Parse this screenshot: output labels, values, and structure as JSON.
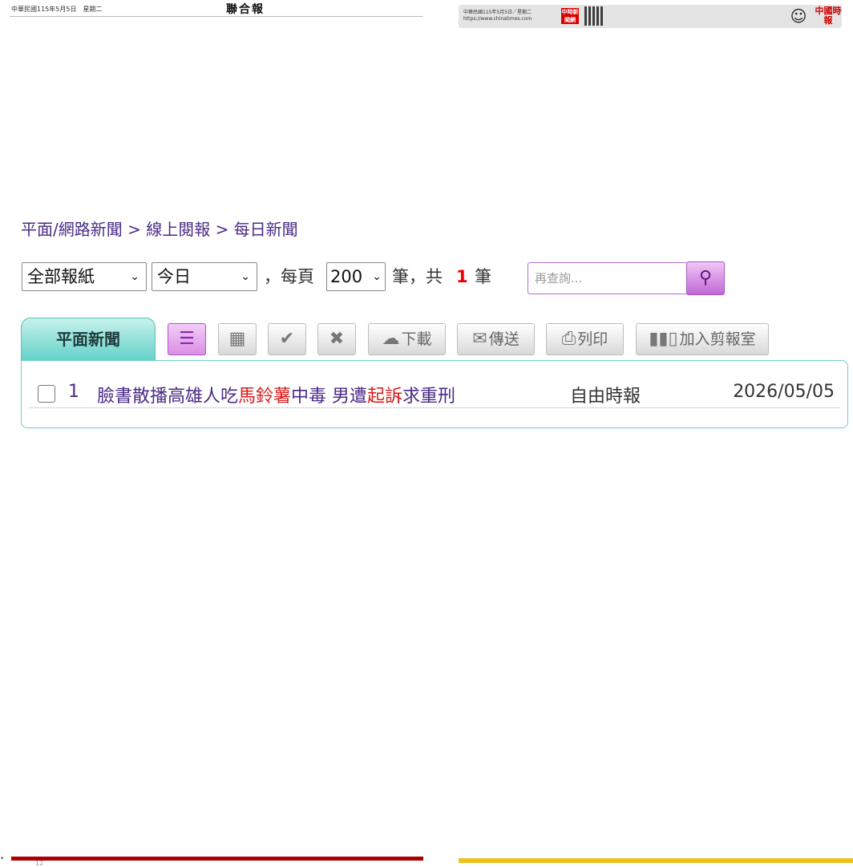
{
  "top_strip_left": {
    "date": "中華民國115年5月5日　星期二",
    "logo": "聯合報"
  },
  "top_strip_right": {
    "date_line1": "中華民國115年5月5日／星期二",
    "date_line2": "https://www.chinatimes.com",
    "badge": "中時新聞網",
    "logo": "中國時報"
  },
  "bottom": {
    "page_number": "12"
  },
  "breadcrumb": "平面/網路新聞 > 線上閱報 > 每日新聞",
  "filters": {
    "paper_select": "全部報紙",
    "date_select": "今日",
    "per_page_prefix": "，每頁",
    "per_page_value": "200",
    "per_page_unit": "筆，共",
    "total": "1",
    "total_unit": "筆",
    "search_placeholder": "再查詢..."
  },
  "tab": {
    "label": "平面新聞"
  },
  "toolbar": {
    "download": "下載",
    "send": "傳送",
    "print": "列印",
    "clip": "加入剪報室"
  },
  "results": [
    {
      "index": "1",
      "title_parts": [
        "臉書散播高雄人吃",
        "馬鈴薯",
        "中毒 男遭",
        "起訴",
        "求重刑"
      ],
      "source": "自由時報",
      "date": "2026/05/05"
    }
  ]
}
